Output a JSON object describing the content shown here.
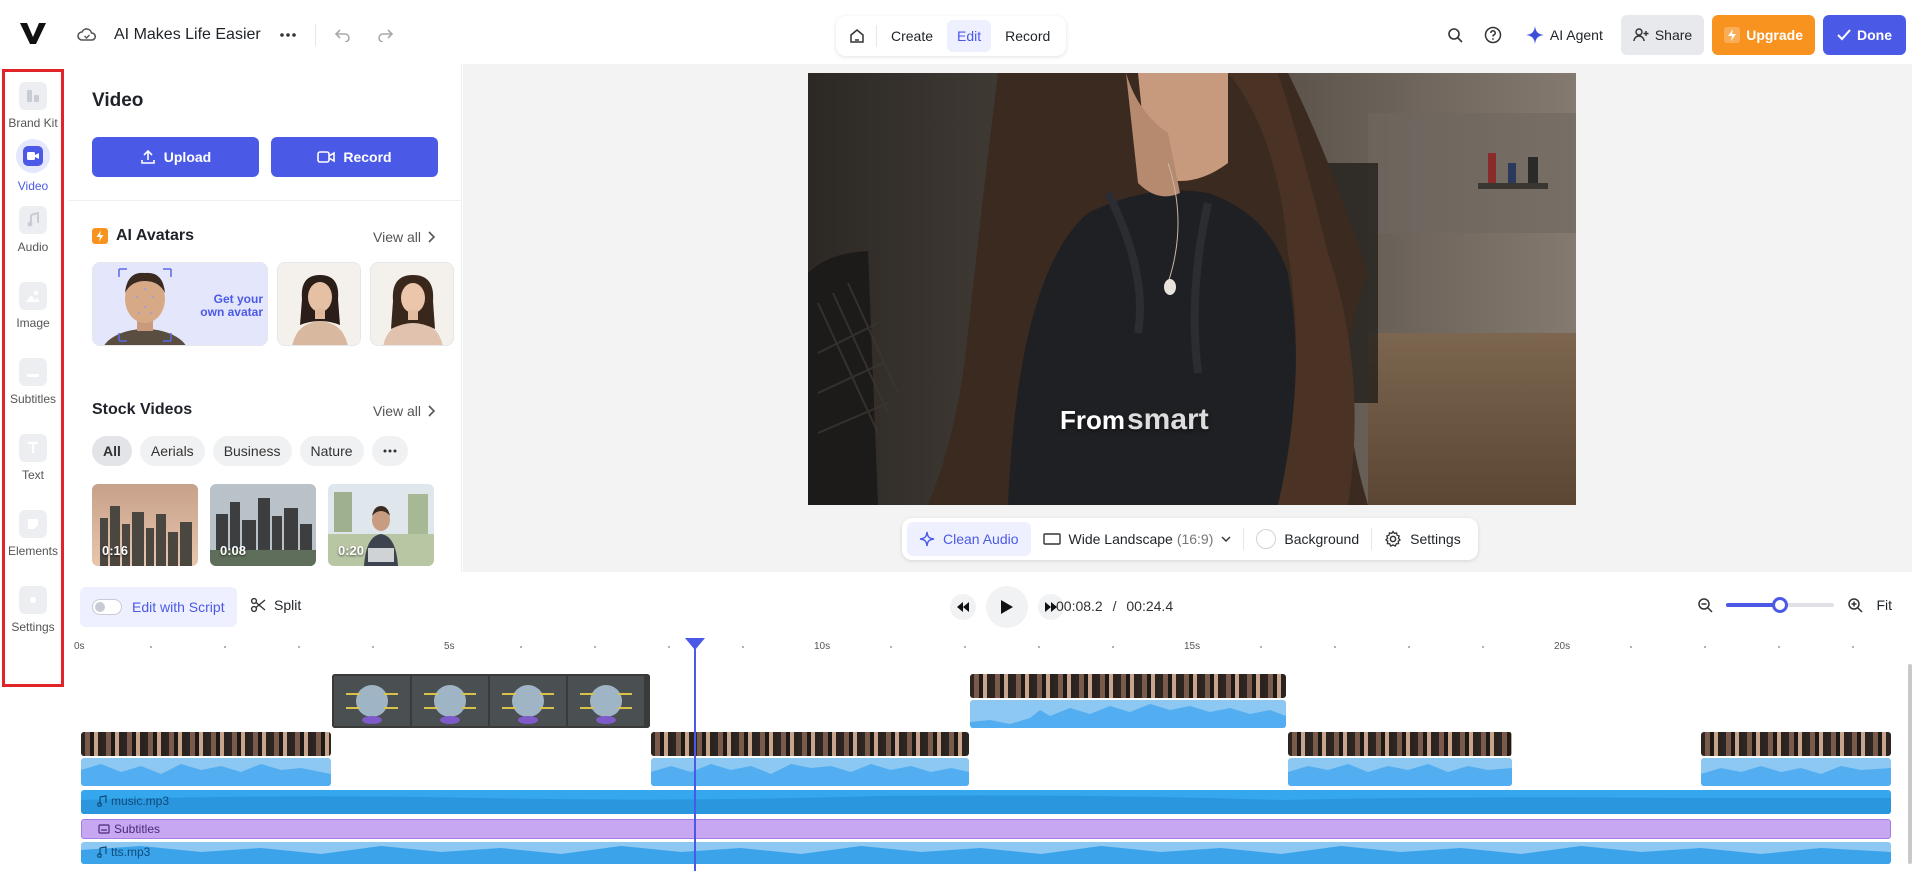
{
  "header": {
    "project_title": "AI Makes Life Easier",
    "modes": [
      "Create",
      "Edit",
      "Record"
    ],
    "active_mode": "Edit",
    "ai_agent_label": "AI Agent",
    "share_label": "Share",
    "upgrade_label": "Upgrade",
    "done_label": "Done"
  },
  "leftnav": {
    "items": [
      {
        "label": "Brand Kit",
        "icon": "brand-kit-icon"
      },
      {
        "label": "Video",
        "icon": "video-camera-icon"
      },
      {
        "label": "Audio",
        "icon": "music-note-icon"
      },
      {
        "label": "Image",
        "icon": "image-icon"
      },
      {
        "label": "Subtitles",
        "icon": "subtitles-icon"
      },
      {
        "label": "Text",
        "icon": "text-icon"
      },
      {
        "label": "Elements",
        "icon": "elements-icon"
      },
      {
        "label": "Settings",
        "icon": "settings-icon"
      }
    ],
    "active": "Video"
  },
  "panel": {
    "title": "Video",
    "upload_label": "Upload",
    "record_label": "Record",
    "avatars_title": "AI Avatars",
    "avatars_view_all": "View all",
    "avatar_promo": "Get your own avatar",
    "stock_title": "Stock Videos",
    "stock_view_all": "View all",
    "filters": [
      "All",
      "Aerials",
      "Business",
      "Nature"
    ],
    "active_filter": "All",
    "thumbs": [
      {
        "duration": "0:16"
      },
      {
        "duration": "0:08"
      },
      {
        "duration": "0:20"
      }
    ]
  },
  "preview": {
    "caption_word1": "From",
    "caption_word2": "smart"
  },
  "video_toolbar": {
    "clean_audio": "Clean Audio",
    "aspect": "Wide Landscape",
    "aspect_ratio": "(16:9)",
    "background": "Background",
    "settings": "Settings"
  },
  "timeline": {
    "edit_script_label": "Edit with Script",
    "split_label": "Split",
    "current_time": "00:08.2",
    "separator": "/",
    "total_time": "00:24.4",
    "fit_label": "Fit",
    "zoom_level": 0.5,
    "ruler_labels": [
      "0s",
      "5s",
      "10s",
      "15s",
      "20s"
    ],
    "tracks": {
      "music": "music.mp3",
      "subtitles": "Subtitles",
      "tts": "tts.mp3"
    }
  },
  "colors": {
    "accent": "#4b5ae6",
    "upgrade": "#f7931e",
    "audio": "#35a7ee",
    "subtitle_track": "#c7a6f2",
    "nav_highlight": "#e0242a"
  }
}
